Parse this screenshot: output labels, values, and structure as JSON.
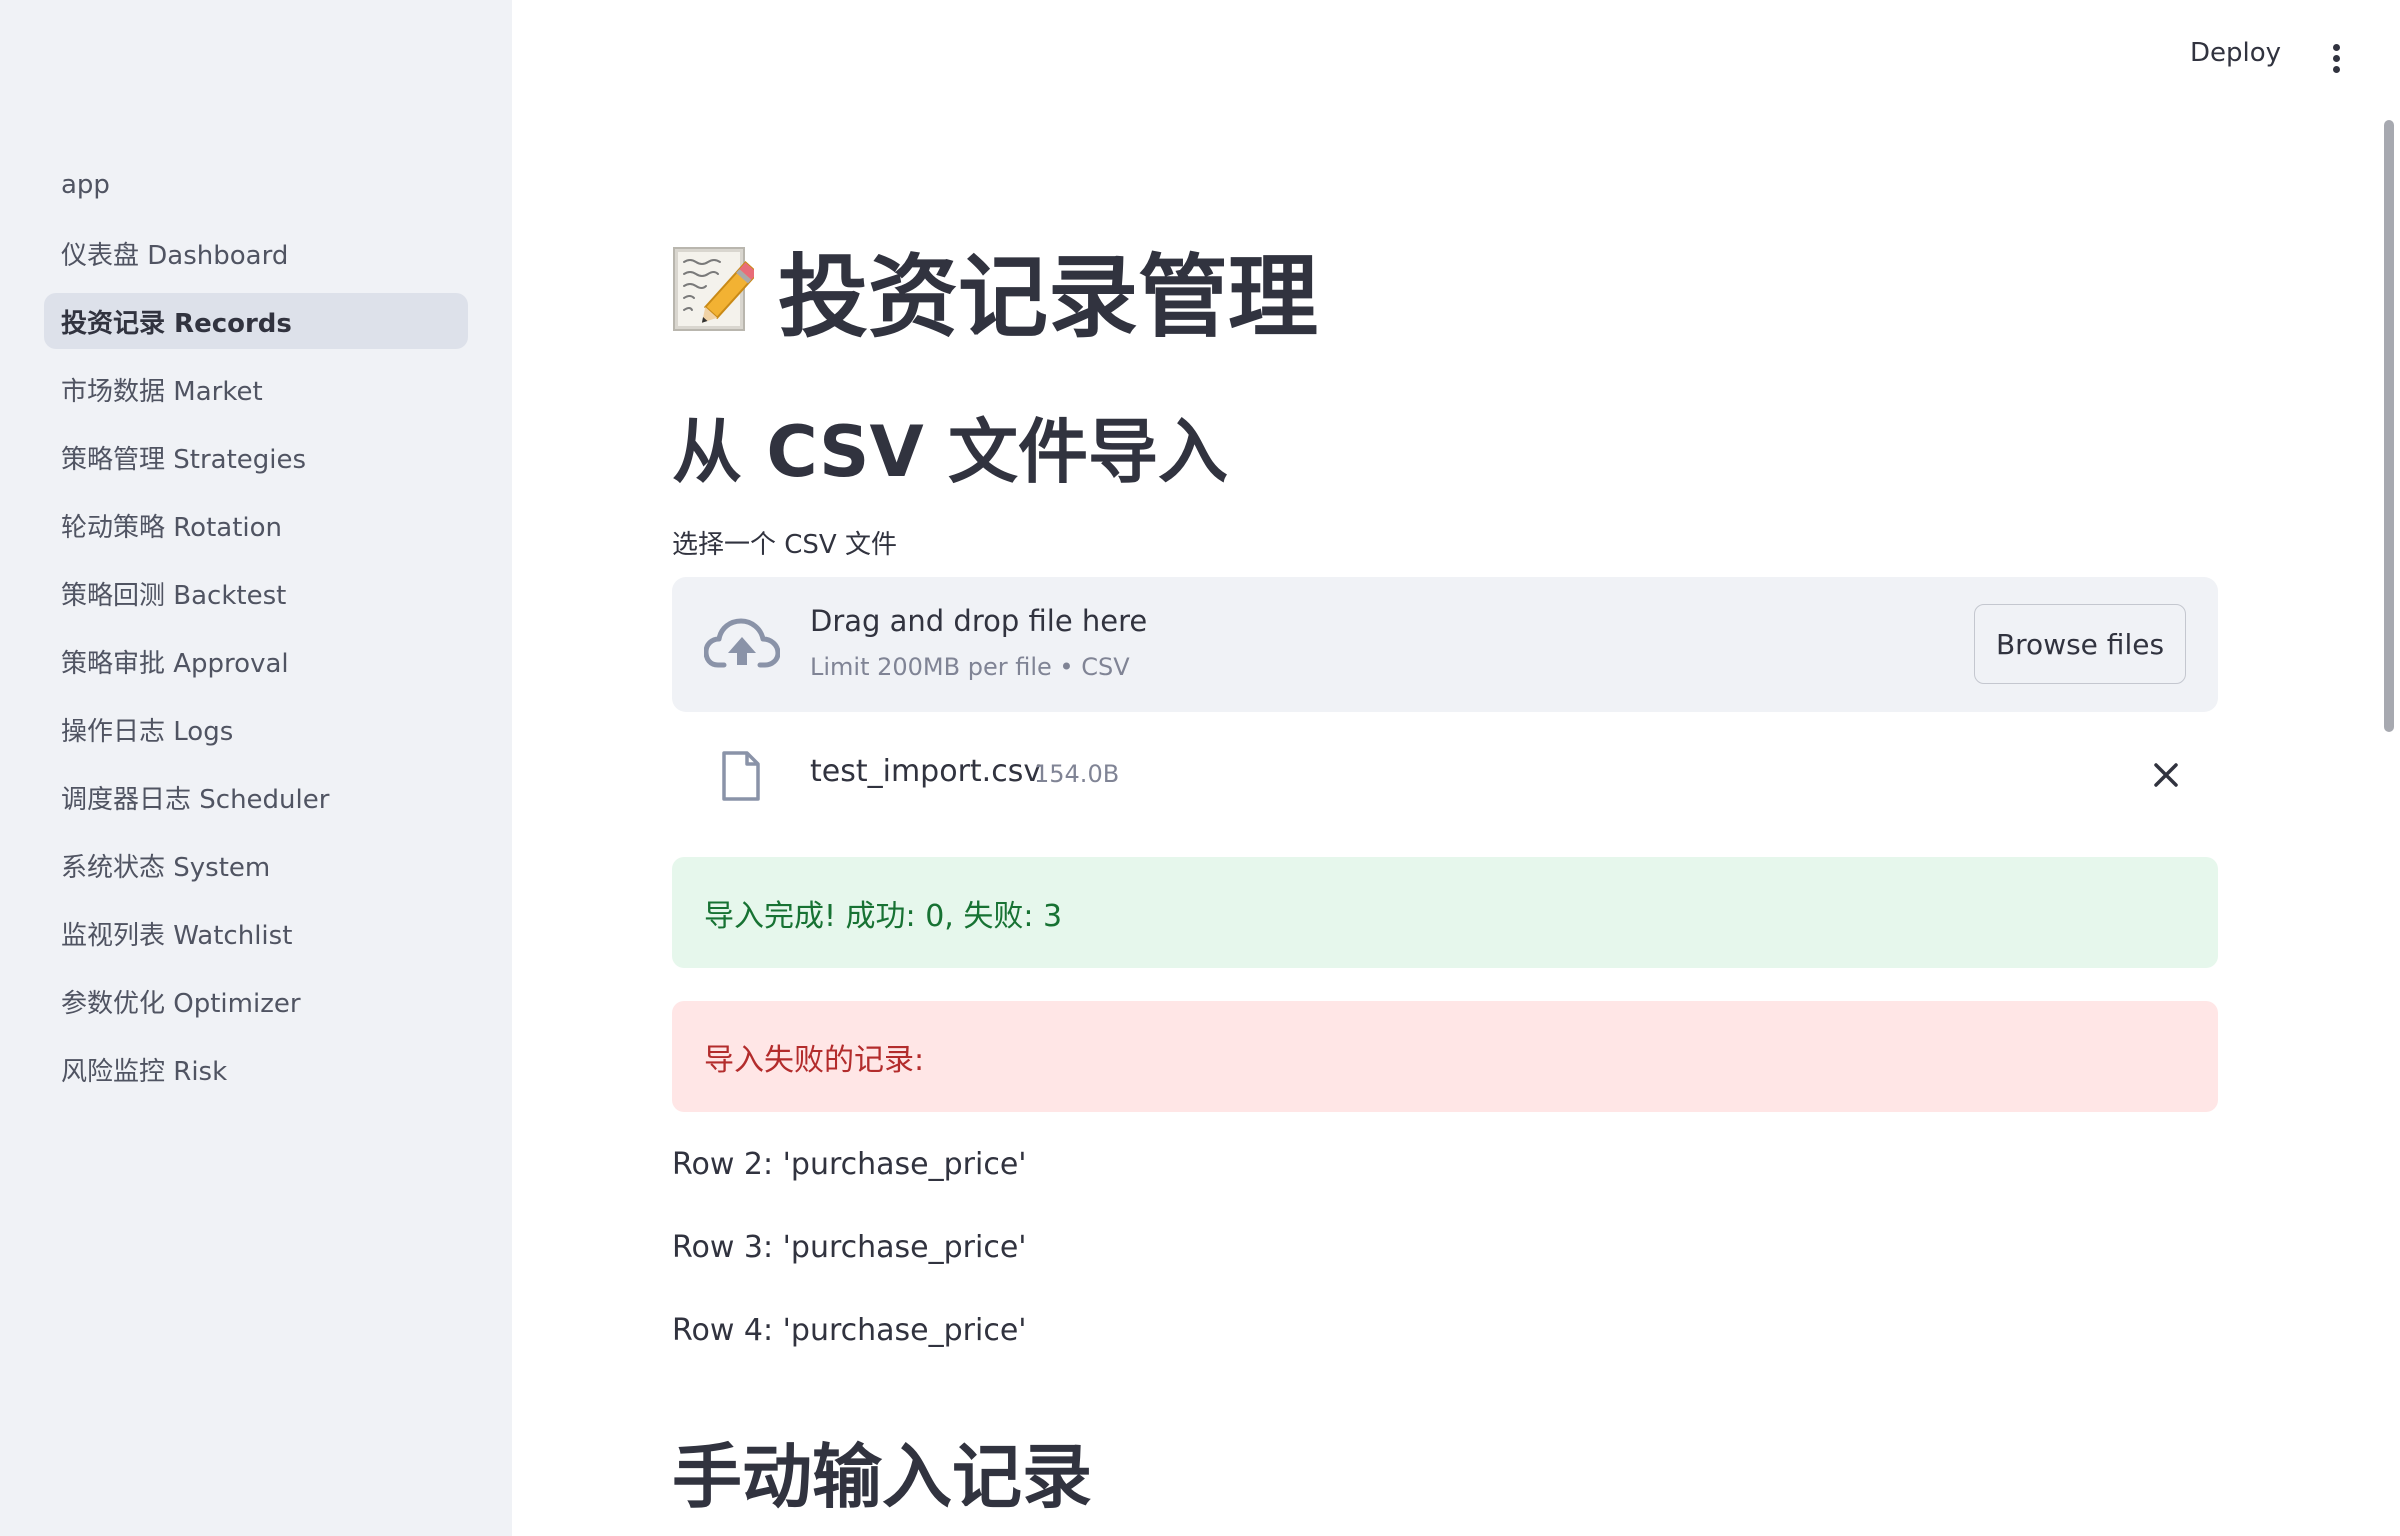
{
  "header": {
    "deploy_label": "Deploy"
  },
  "sidebar": {
    "items": [
      {
        "label": "app"
      },
      {
        "label": "仪表盘 Dashboard"
      },
      {
        "label": "投资记录 Records",
        "active": true
      },
      {
        "label": "市场数据 Market"
      },
      {
        "label": "策略管理 Strategies"
      },
      {
        "label": "轮动策略 Rotation"
      },
      {
        "label": "策略回测 Backtest"
      },
      {
        "label": "策略审批 Approval"
      },
      {
        "label": "操作日志 Logs"
      },
      {
        "label": "调度器日志 Scheduler"
      },
      {
        "label": "系统状态 System"
      },
      {
        "label": "监视列表 Watchlist"
      },
      {
        "label": "参数优化 Optimizer"
      },
      {
        "label": "风险监控 Risk"
      }
    ]
  },
  "main": {
    "title": "投资记录管理",
    "title_icon": "memo-icon",
    "import_heading": "从 CSV 文件导入",
    "uploader": {
      "label": "选择一个 CSV 文件",
      "dropzone_title": "Drag and drop file here",
      "dropzone_limit": "Limit 200MB per file • CSV",
      "browse_label": "Browse files",
      "file": {
        "name": "test_import.csv",
        "size": "154.0B"
      }
    },
    "success_message": "导入完成! 成功: 0, 失败: 3",
    "error_message": "导入失败的记录:",
    "error_rows": [
      "Row 2: 'purchase_price'",
      "Row 3: 'purchase_price'",
      "Row 4: 'purchase_price'"
    ],
    "manual_heading": "手动输入记录"
  },
  "colors": {
    "sidebar_bg": "#f0f2f6",
    "active_nav_bg": "#dde1ea",
    "success_bg": "#e6f7ec",
    "success_text": "#177233",
    "error_bg": "#ffe6e6",
    "error_text": "#b32c2c"
  }
}
